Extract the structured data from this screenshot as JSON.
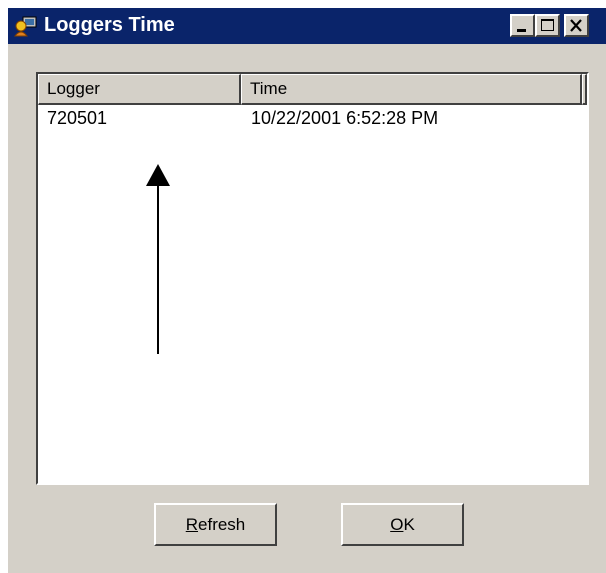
{
  "window": {
    "title": "Loggers Time",
    "icon": "app-icon",
    "controls": [
      "minimize-icon",
      "maximize-icon",
      "close-icon"
    ]
  },
  "list": {
    "columns": [
      "Logger",
      "Time"
    ],
    "rows": [
      {
        "logger": "720501",
        "time": "10/22/2001 6:52:28 PM"
      }
    ]
  },
  "buttons": {
    "refresh": {
      "accel": "R",
      "rest": "efresh"
    },
    "ok": {
      "accel": "O",
      "rest": "K"
    }
  },
  "colors": {
    "titlebar": "#0a246a",
    "face": "#d4d0c8",
    "list_bg": "#ffffff"
  }
}
